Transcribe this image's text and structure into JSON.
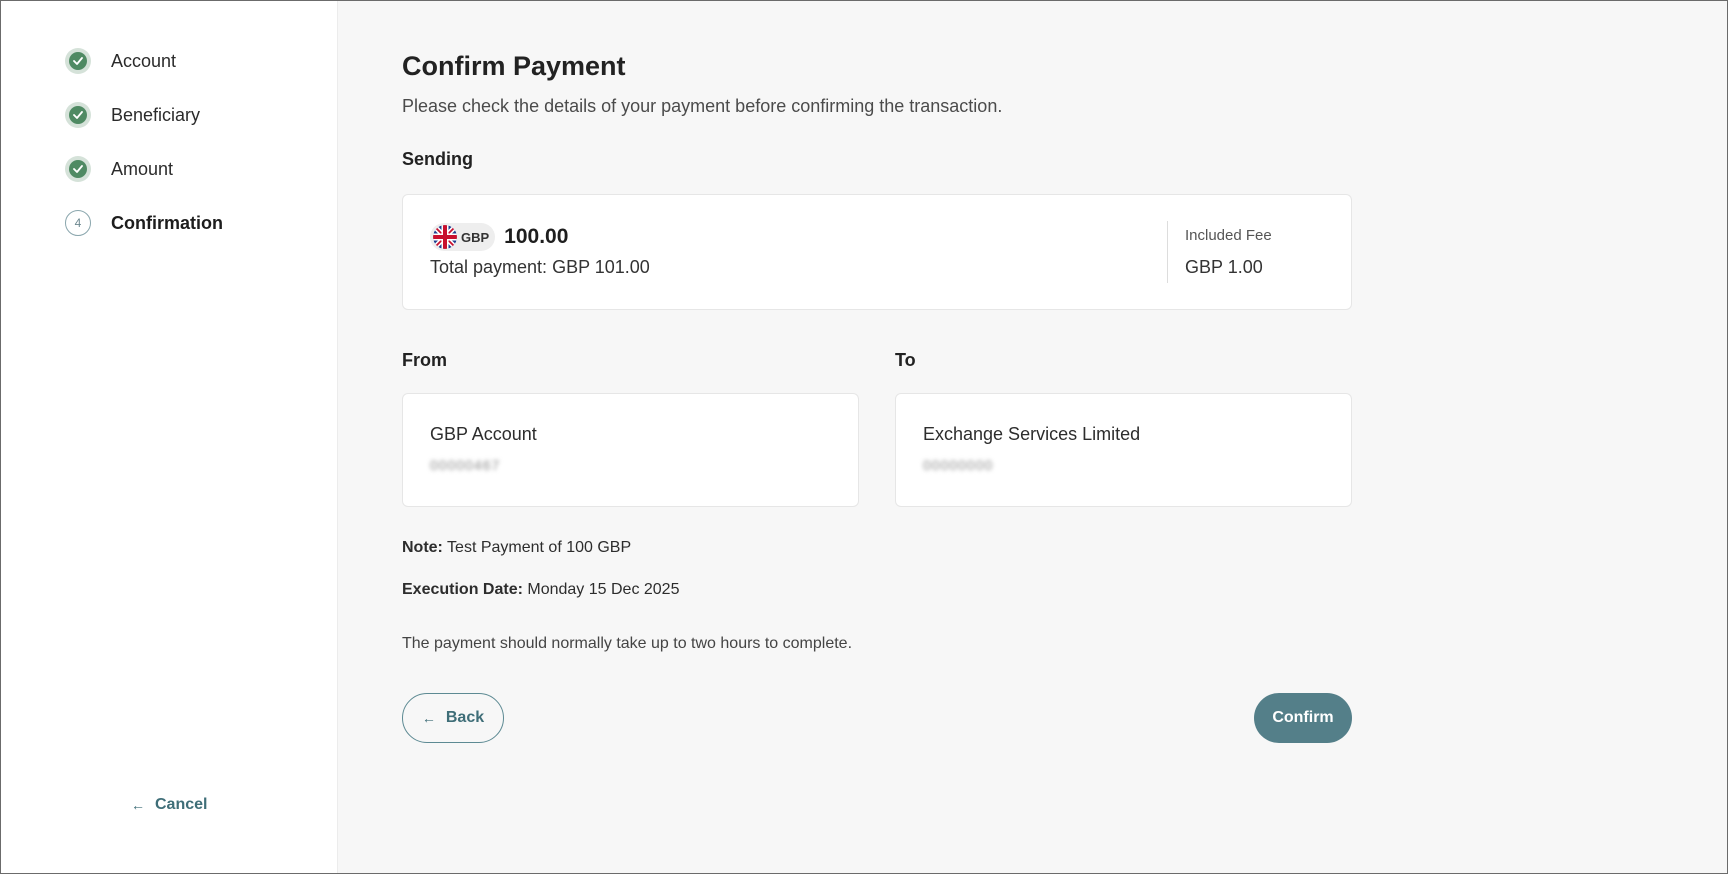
{
  "sidebar": {
    "steps": [
      {
        "label": "Account",
        "state": "done"
      },
      {
        "label": "Beneficiary",
        "state": "done"
      },
      {
        "label": "Amount",
        "state": "done"
      },
      {
        "label": "Confirmation",
        "state": "current",
        "number": "4"
      }
    ],
    "cancel_label": "Cancel",
    "cancel_icon": "arrow-left-icon"
  },
  "main": {
    "title": "Confirm Payment",
    "subtitle": "Please check the details of your payment before confirming the transaction.",
    "sending": {
      "label": "Sending",
      "flag_icon": "uk-flag-icon",
      "currency": "GBP",
      "amount": "100.00",
      "total_payment": "Total payment: GBP 101.00",
      "fee_label": "Included Fee",
      "fee_value": "GBP 1.00"
    },
    "from": {
      "label": "From",
      "account_name": "GBP Account",
      "account_number_masked": "00000467"
    },
    "to": {
      "label": "To",
      "account_name": "Exchange Services Limited",
      "account_number_masked": "00000000"
    },
    "note": {
      "label": "Note:",
      "value": "Test Payment of 100 GBP"
    },
    "execution_date": {
      "label": "Execution Date:",
      "value": "Monday 15 Dec 2025"
    },
    "info": "The payment should normally take up to two hours to complete.",
    "back_label": "Back",
    "confirm_label": "Confirm"
  },
  "colors": {
    "accent": "#547f89",
    "success": "#4f8a63",
    "background": "#f7f7f7"
  }
}
